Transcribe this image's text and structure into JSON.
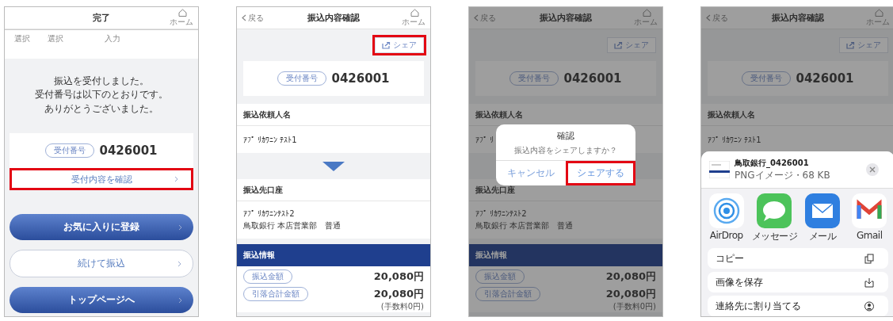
{
  "screens": [
    {
      "kind": "complete",
      "dimmed": false,
      "header": {
        "title": "完了",
        "home": "ホーム"
      },
      "steps": [
        "選択",
        "選択",
        "入力"
      ],
      "message": [
        "振込を受付しました。",
        "受付番号は以下のとおりです。",
        "ありがとうございました。"
      ],
      "receipt": {
        "label": "受付番号",
        "number": "0426001"
      },
      "link": {
        "label": "受付内容を確認",
        "highlighted": true
      },
      "buttons": [
        {
          "label": "お気に入りに登録",
          "kind": "primary"
        },
        {
          "label": "続けて振込",
          "kind": "secondary"
        },
        {
          "label": "トップページへ",
          "kind": "primary"
        }
      ]
    },
    {
      "kind": "detail",
      "dimmed": false,
      "header": {
        "back": "戻る",
        "title": "振込内容確認",
        "home": "ホーム"
      },
      "share": {
        "label": "シェア",
        "highlighted": true
      },
      "receipt": {
        "label": "受付番号",
        "number": "0426001"
      },
      "sender": {
        "heading": "振込依頼人名",
        "name": "ｱﾌﾟ ﾘｶﾜﾆﾝ ﾃｽﾄ1"
      },
      "arrow": true,
      "payee": {
        "heading": "振込先口座",
        "name": "ｱﾌﾟ ﾘｶﾜﾆﾝﾃｽﾄ2",
        "branch": "鳥取銀行 本店営業部　普通"
      },
      "info": {
        "heading": "振込情報",
        "rows": [
          {
            "label": "振込金額",
            "value": "20,080円"
          },
          {
            "label": "引落合計金額",
            "value": "20,080円",
            "note": "(手数料0円)"
          }
        ]
      }
    },
    {
      "kind": "detail",
      "dimmed": true,
      "header": {
        "back": "戻る",
        "title": "振込内容確認",
        "home": "ホーム"
      },
      "share": {
        "label": "シェア",
        "highlighted": false
      },
      "receipt": {
        "label": "受付番号",
        "number": "0426001"
      },
      "sender": {
        "heading": "振込依頼人名",
        "name": "ｱﾌﾟ ﾘ"
      },
      "payee": {
        "heading": "振込先口座",
        "name": "ｱﾌﾟ ﾘｶﾜﾆﾝﾃｽﾄ2",
        "branch": "鳥取銀行 本店営業部　普通"
      },
      "info": {
        "heading": "振込情報",
        "rows": [
          {
            "label": "振込金額",
            "value": "20,080円"
          },
          {
            "label": "引落合計金額",
            "value": "20,080円",
            "note": "(手数料0円)"
          }
        ]
      },
      "dialog": {
        "title": "確認",
        "message": "振込内容をシェアしますか？",
        "buttons": [
          {
            "label": "キャンセル",
            "kind": "cancel",
            "highlighted": false
          },
          {
            "label": "シェアする",
            "kind": "confirm",
            "highlighted": true
          }
        ]
      }
    },
    {
      "kind": "detail",
      "dimmed": true,
      "header": {
        "back": "戻る",
        "title": "振込内容確認",
        "home": "ホーム"
      },
      "share": {
        "label": "シェア",
        "highlighted": false
      },
      "receipt": {
        "label": "受付番号",
        "number": "0426001"
      },
      "sender": {
        "heading": "振込依頼人名",
        "name": "ｱﾌﾟ ﾘｶﾜﾆﾝ ﾃｽﾄ1"
      },
      "share_sheet": {
        "file": {
          "name": "鳥取銀行_0426001",
          "meta": "PNGイメージ・68 KB"
        },
        "apps": [
          {
            "kind": "airdrop",
            "label": "AirDrop"
          },
          {
            "kind": "messages",
            "label": "メッセージ"
          },
          {
            "kind": "mail",
            "label": "メール"
          },
          {
            "kind": "gmail",
            "label": "Gmail"
          }
        ],
        "actions": [
          {
            "kind": "copy",
            "label": "コピー"
          },
          {
            "kind": "save",
            "label": "画像を保存"
          },
          {
            "kind": "contact",
            "label": "連絡先に割り当てる"
          }
        ]
      }
    }
  ]
}
